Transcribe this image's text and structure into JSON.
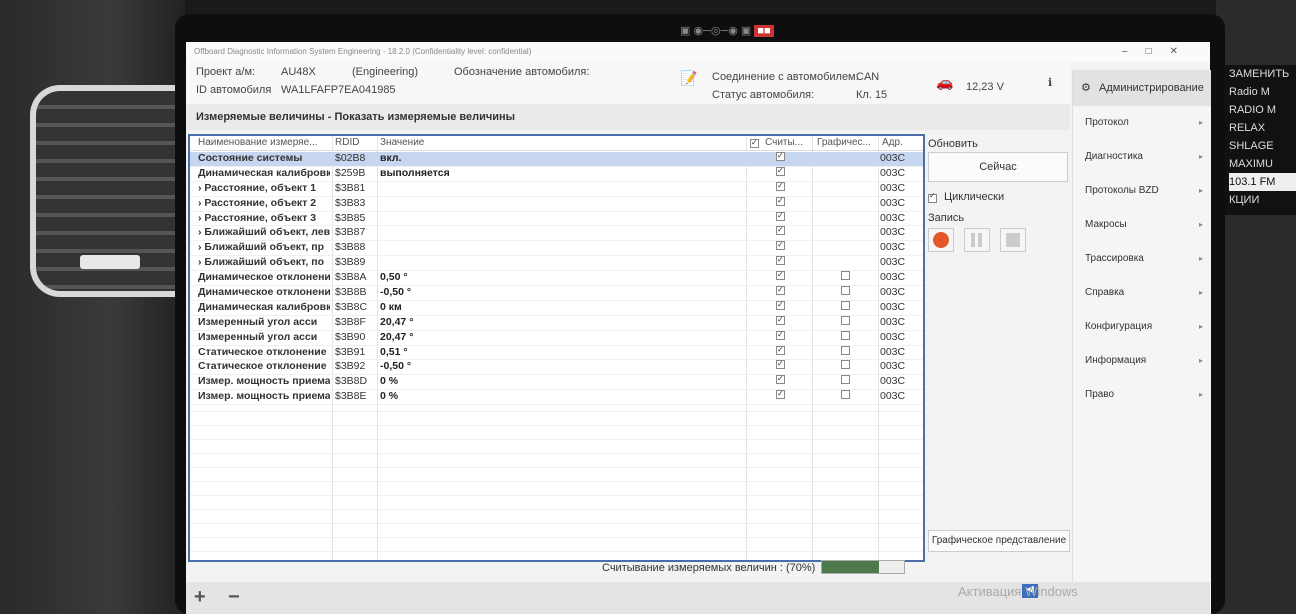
{
  "window": {
    "title": "Offboard Diagnostic Information System Engineering - 18.2.0 (Confidentiality level: confidential)"
  },
  "header": {
    "project_label": "Проект а/м:",
    "project_value": "AU48X",
    "mode": "(Engineering)",
    "designation_label": "Обозначение автомобиля:",
    "id_label": "ID автомобиля",
    "id_value": "WA1LFAFP7EA041985",
    "connection_label": "Соединение с автомобилем:",
    "connection_value": "CAN",
    "status_label": "Статус автомобиля:",
    "status_value": "Кл. 15",
    "voltage": "12,23 V"
  },
  "breadcrumb": "Измеряемые величины - Показать измеряемые величины",
  "table": {
    "columns": {
      "name": "Наименование измеряе...",
      "rdid": "RDID",
      "value": "Значение",
      "read": "Считы...",
      "graph": "Графичес...",
      "adr": "Адр."
    },
    "rows": [
      {
        "name": "Состояние системы",
        "rdid": "$02B8",
        "value": "вкл.",
        "read": true,
        "graph": null,
        "adr": "003C"
      },
      {
        "name": "Динамическая калибровка",
        "rdid": "$259B",
        "value": "выполняется",
        "read": true,
        "graph": null,
        "adr": "003C"
      },
      {
        "name": "› Расстояние, объект 1",
        "rdid": "$3B81",
        "value": "",
        "read": true,
        "graph": null,
        "adr": "003C"
      },
      {
        "name": "› Расстояние, объект 2",
        "rdid": "$3B83",
        "value": "",
        "read": true,
        "graph": null,
        "adr": "003C"
      },
      {
        "name": "› Расстояние, объект 3",
        "rdid": "$3B85",
        "value": "",
        "read": true,
        "graph": null,
        "adr": "003C"
      },
      {
        "name": "› Ближайший объект, лев",
        "rdid": "$3B87",
        "value": "",
        "read": true,
        "graph": null,
        "adr": "003C"
      },
      {
        "name": "› Ближайший объект, пр",
        "rdid": "$3B88",
        "value": "",
        "read": true,
        "graph": null,
        "adr": "003C"
      },
      {
        "name": "› Ближайший объект, по",
        "rdid": "$3B89",
        "value": "",
        "read": true,
        "graph": null,
        "adr": "003C"
      },
      {
        "name": "Динамическое отклонение",
        "rdid": "$3B8A",
        "value": "0,50 °",
        "read": true,
        "graph": false,
        "adr": "003C"
      },
      {
        "name": "Динамическое отклонение",
        "rdid": "$3B8B",
        "value": "-0,50 °",
        "read": true,
        "graph": false,
        "adr": "003C"
      },
      {
        "name": "Динамическая калибровка",
        "rdid": "$3B8C",
        "value": "0 км",
        "read": true,
        "graph": false,
        "adr": "003C"
      },
      {
        "name": "Измеренный угол асси",
        "rdid": "$3B8F",
        "value": "20,47 °",
        "read": true,
        "graph": false,
        "adr": "003C"
      },
      {
        "name": "Измеренный угол асси",
        "rdid": "$3B90",
        "value": "20,47 °",
        "read": true,
        "graph": false,
        "adr": "003C"
      },
      {
        "name": "Статическое отклонение",
        "rdid": "$3B91",
        "value": "0,51 °",
        "read": true,
        "graph": false,
        "adr": "003C"
      },
      {
        "name": "Статическое отклонение",
        "rdid": "$3B92",
        "value": "-0,50 °",
        "read": true,
        "graph": false,
        "adr": "003C"
      },
      {
        "name": "Измер. мощность приема",
        "rdid": "$3B8D",
        "value": "0 %",
        "read": true,
        "graph": false,
        "adr": "003C"
      },
      {
        "name": "Измер. мощность приема",
        "rdid": "$3B8E",
        "value": "0 %",
        "read": true,
        "graph": false,
        "adr": "003C"
      }
    ]
  },
  "side": {
    "refresh_label": "Обновить",
    "now_button": "Сейчас",
    "cyclic_label": "Циклически",
    "record_label": "Запись",
    "graph_button": "Графическое представление"
  },
  "status_text": "Считывание измеряемых величин : (70%)",
  "progress_fraction": 0.7,
  "menu": {
    "top": "Администрирование",
    "items": [
      "Протокол",
      "Диагностика",
      "Протоколы BZD",
      "Макросы",
      "Трассировка",
      "Справка",
      "Конфигурация",
      "Информация",
      "Право"
    ]
  },
  "windows_activation": "Активация Windows",
  "radio": [
    "ЗАМЕНИТЬ",
    "Radio M",
    "RADIO M",
    "RELAX",
    "SHLAGE",
    "MAXIMU",
    "103.1 FM",
    "КЦИИ"
  ],
  "colors": {
    "selection": "#c6d6ee",
    "accent_blue": "#2f5fb0",
    "progress": "#4c7a4c"
  }
}
